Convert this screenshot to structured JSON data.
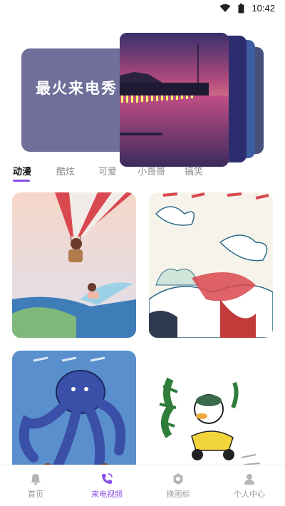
{
  "status_bar": {
    "time": "10:42",
    "icons": [
      "wifi-icon",
      "battery-icon"
    ]
  },
  "banner": {
    "title": "最火来电秀"
  },
  "tabs": [
    {
      "label": "动漫",
      "active": true
    },
    {
      "label": "酷炫",
      "active": false
    },
    {
      "label": "可爱",
      "active": false
    },
    {
      "label": "小哥哥",
      "active": false
    },
    {
      "label": "搞笑",
      "active": false
    }
  ],
  "bottom_nav": [
    {
      "label": "首页",
      "icon": "bell-icon",
      "active": false
    },
    {
      "label": "来电视频",
      "icon": "phone-icon",
      "active": true
    },
    {
      "label": "换图标",
      "icon": "gear-icon",
      "active": false
    },
    {
      "label": "个人中心",
      "icon": "person-icon",
      "active": false
    }
  ],
  "colors": {
    "accent": "#8a4fe6",
    "banner": "#6f6f9a",
    "inactive": "#9a9a9a"
  }
}
